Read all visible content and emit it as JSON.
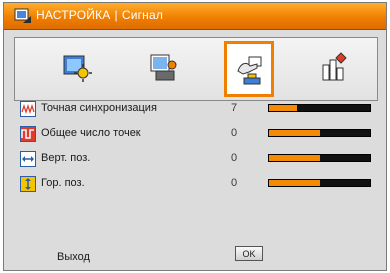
{
  "header": {
    "title": "НАСТРОЙКА",
    "subtitle": "Сигнал",
    "separator": "|"
  },
  "tabs": [
    {
      "icon": "image-settings-icon",
      "selected": false
    },
    {
      "icon": "display-settings-icon",
      "selected": false
    },
    {
      "icon": "setup-hand-icon",
      "selected": true
    },
    {
      "icon": "options-icon",
      "selected": false
    }
  ],
  "rows": [
    {
      "label": "Точная синхронизация",
      "value": "7",
      "level": 0.28,
      "icon": "phase-icon"
    },
    {
      "label": "Общее число точек",
      "value": "0",
      "level": 0.5,
      "icon": "clock-icon"
    },
    {
      "label": "Верт. поз.",
      "value": "0",
      "level": 0.5,
      "icon": "horizontal-position-icon"
    },
    {
      "label": "Гор. поз.",
      "value": "0",
      "level": 0.5,
      "icon": "vertical-position-icon"
    }
  ],
  "footer": {
    "exit_label": "Выход",
    "ok_label": "OK"
  },
  "colors": {
    "accent": "#f07f00",
    "bar_fill": "#f58a07",
    "bar_track": "#111111",
    "panel": "#dcdcdc"
  }
}
